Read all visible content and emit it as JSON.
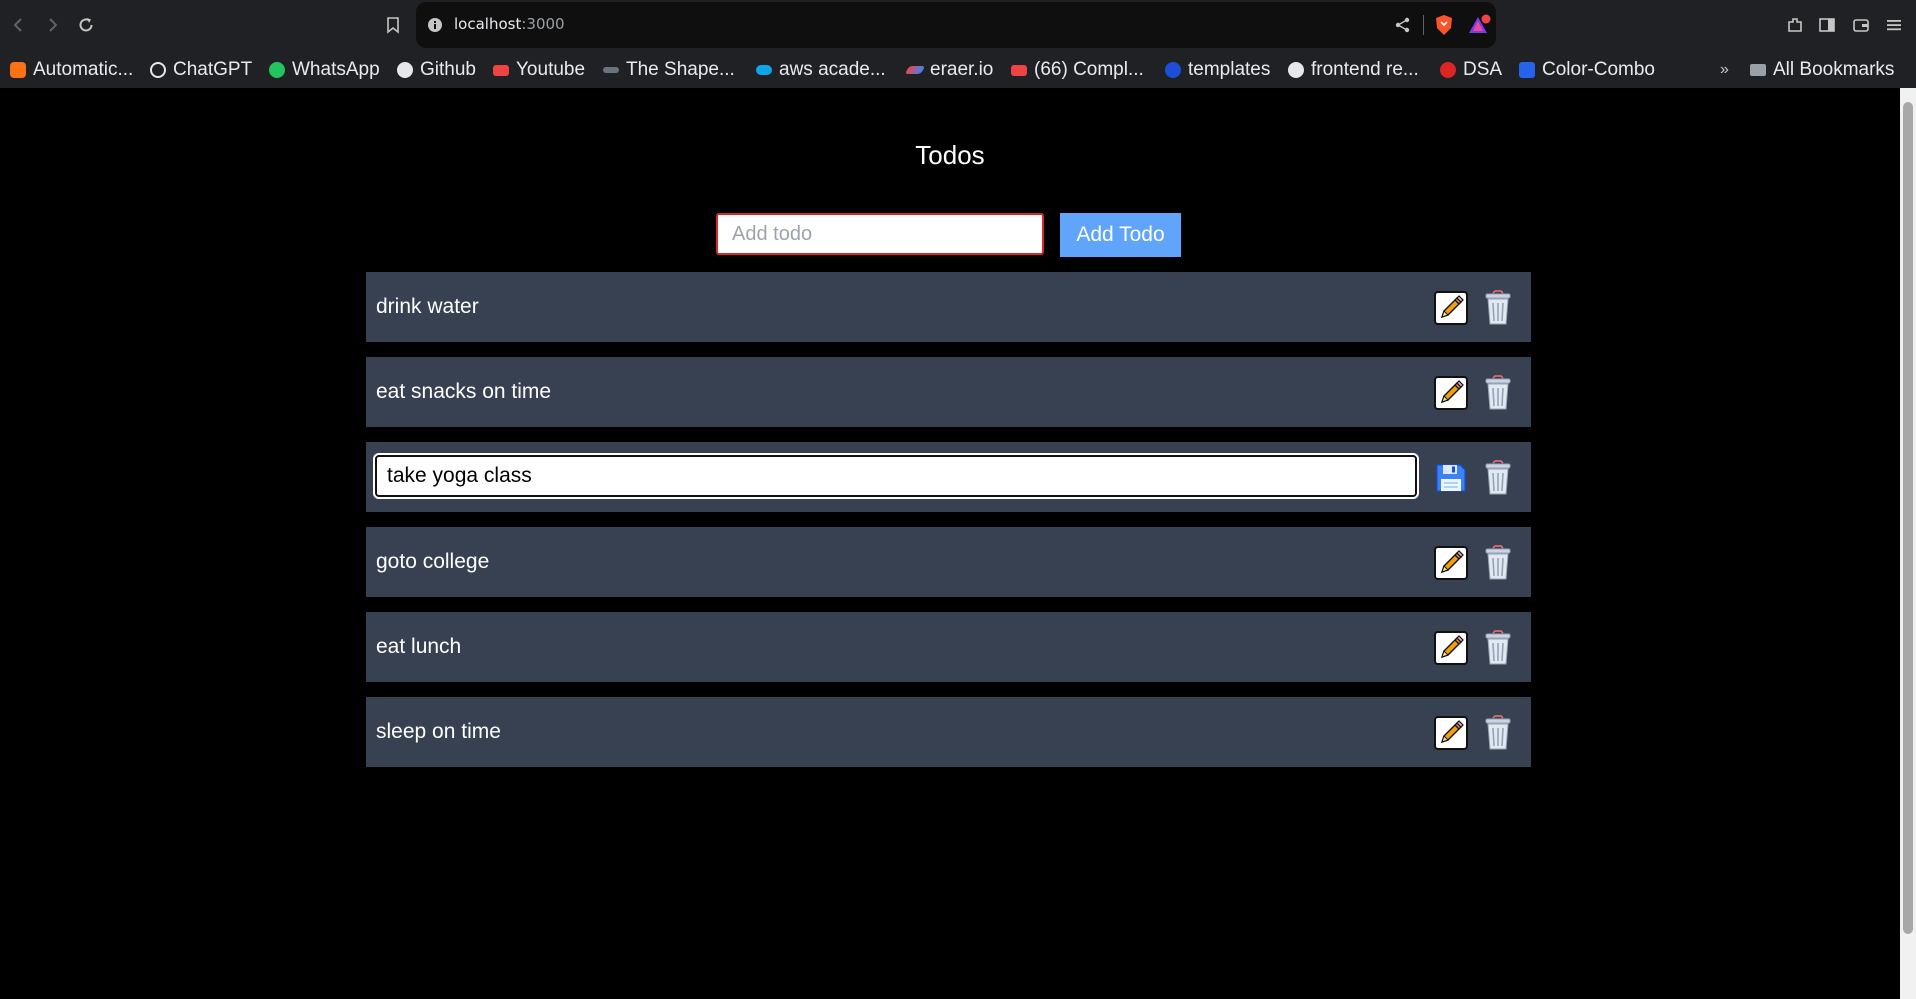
{
  "browser": {
    "url_host": "localhost",
    "url_port": ":3000",
    "bookmarks": [
      {
        "label": "Automatic...",
        "color": "#f97316"
      },
      {
        "label": "ChatGPT",
        "color": "#e5e7eb"
      },
      {
        "label": "WhatsApp",
        "color": "#22c55e"
      },
      {
        "label": "Github",
        "color": "#e5e7eb"
      },
      {
        "label": "Youtube",
        "color": "#ef4444"
      },
      {
        "label": "The Shape...",
        "color": "#9ca3af"
      },
      {
        "label": "aws acade...",
        "color": "#0ea5e9"
      },
      {
        "label": "eraer.io",
        "color": "#ef4444"
      },
      {
        "label": "(66) Compl...",
        "color": "#ef4444"
      },
      {
        "label": "templates",
        "color": "#1d4ed8"
      },
      {
        "label": "frontend re...",
        "color": "#e5e7eb"
      },
      {
        "label": "DSA",
        "color": "#dc2626"
      },
      {
        "label": "Color-Combo",
        "color": "#2563eb"
      }
    ],
    "overflow_label": "»",
    "all_bookmarks_label": "All Bookmarks"
  },
  "app": {
    "title": "Todos",
    "add_placeholder": "Add todo",
    "add_button_label": "Add Todo",
    "todos": [
      {
        "text": "drink water",
        "editing": false
      },
      {
        "text": "eat snacks on time",
        "editing": false
      },
      {
        "text": "take yoga class",
        "editing": true
      },
      {
        "text": "goto college",
        "editing": false
      },
      {
        "text": "eat lunch",
        "editing": false
      },
      {
        "text": "sleep on time",
        "editing": false
      }
    ]
  },
  "colors": {
    "row_background": "#374151",
    "add_button": "#60a5fa",
    "input_error_border": "#dc2626"
  }
}
